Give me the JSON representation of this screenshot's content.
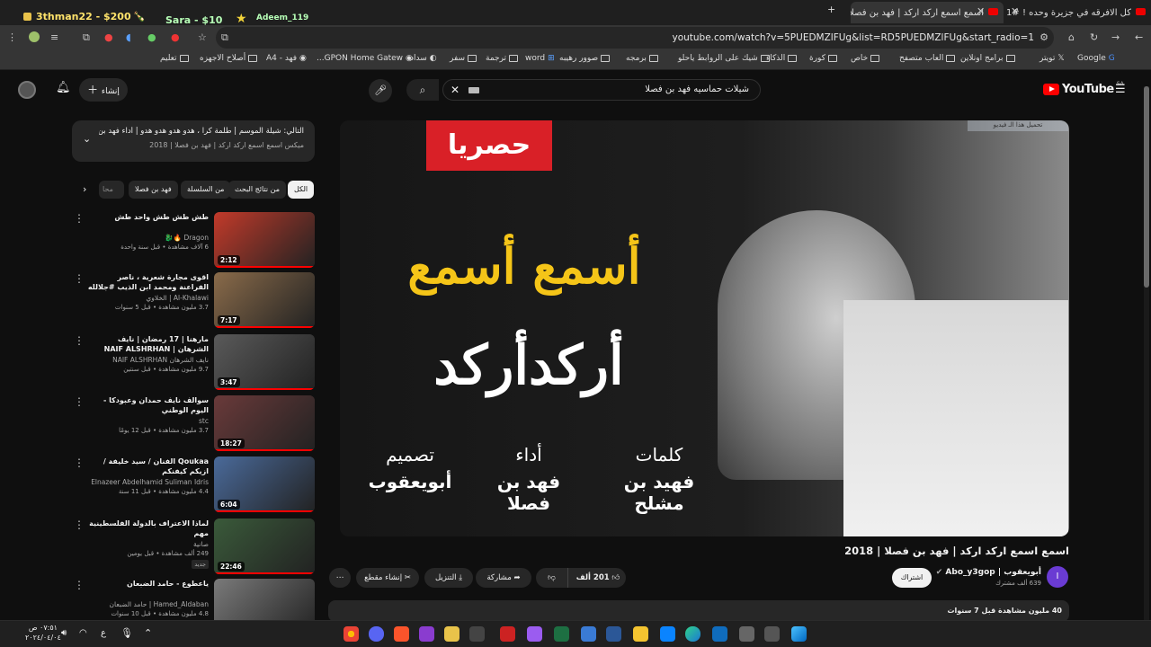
{
  "overlay": {
    "user1": "3thman22 - $200",
    "user2": "Sara - $10",
    "user3": "Adeem_119"
  },
  "tabs": [
    {
      "title": "كل الافرقه في جزيرة وحده ! #1 -"
    },
    {
      "title": "اسمع اسمع اركد اركد | فهد بن فصلا"
    },
    {
      "title": "فهد بن"
    }
  ],
  "address": {
    "url": "youtube.com/watch?v=5PUEDMZlFUg&list=RD5PUEDMZlFUg&start_radio=1"
  },
  "bookmarks": [
    {
      "label": "Google"
    },
    {
      "label": "تويتر"
    },
    {
      "label": "برامج اونلاين"
    },
    {
      "label": "العاب متصفح"
    },
    {
      "label": "خاص"
    },
    {
      "label": "كورة"
    },
    {
      "label": "الذكاء"
    },
    {
      "label": "شيك على الروابط ياحلو"
    },
    {
      "label": "برمجه"
    },
    {
      "label": "صوور رهيبه"
    },
    {
      "label": "word"
    },
    {
      "label": "ترجمة"
    },
    {
      "label": "سفر"
    },
    {
      "label": "سداد"
    },
    {
      "label": "GPON Home Gatew..."
    },
    {
      "label": "فهد - A4"
    },
    {
      "label": "أصلاح الاجهزه"
    },
    {
      "label": "تعليم"
    }
  ],
  "yt": {
    "logo": "YouTube",
    "region": "SA",
    "search_value": "شيلات حماسيه فهد بن فصلا",
    "create_label": "إنشاء"
  },
  "next": {
    "line1": "التالي: شيلة الموسم | طلمة كرا ، هدو هدو هدو هدو | أداء فهد بن فصلا | ...",
    "line2": "ميكس اسمع اسمع اركد اركد | فهد بن فصلا | 2018"
  },
  "chips": [
    "الكل",
    "من نتائج البحث",
    "من السلسلة",
    "فهد بن فصلا",
    "محا"
  ],
  "recs": [
    {
      "title": "طش طش طش واحد طش",
      "channel": "Dragon 🔥🐉",
      "meta": "6 آلاف مشاهدة • قبل سنة واحدة",
      "duration": "2:12",
      "thumb_color": "#c23a2a"
    },
    {
      "title": "اقوى مجارة شعرية ، ناصر الفراعنة ومحمد ابن الذيب #جلالله",
      "channel": "Al-Khalawi | الخلاوي",
      "meta": "3.7 مليون مشاهدة • قبل 5 سنوات",
      "duration": "7:17",
      "thumb_color": "#8a6b4a"
    },
    {
      "title": "مارهنا | 17 رمضان | نايف الشرهان | NAIF ALSHRHAN",
      "channel": "نايف الشرهان NAIF ALSHRHAN",
      "meta": "9.7 مليون مشاهدة • قبل سنتين",
      "duration": "3:47",
      "thumb_color": "#5a5a5a"
    },
    {
      "title": "سوالف نايف حمدان وعبودكا - اليوم الوطني",
      "channel": "stc",
      "meta": "3.7 مليون مشاهدة • قبل 12 يومًا",
      "duration": "18:27",
      "thumb_color": "#6a3a3a"
    },
    {
      "title": "Qoukaa الفنان / سيد خليفة / ازيكم كيفنكم",
      "channel": "Elnazeer Abdelhamid Suliman Idris",
      "meta": "4.4 مليون مشاهدة • قبل 11 سنة",
      "duration": "6:04",
      "thumb_color": "#4a6a9a"
    },
    {
      "title": "لماذا الاعتراف بالدولة الفلسطينية مهم",
      "channel": "صانية",
      "meta": "249 ألف مشاهدة • قبل يومين",
      "duration": "22:46",
      "thumb_color": "#3a5a3a",
      "badge": "جديد"
    },
    {
      "title": "ياعطوع - حامد الضبعان",
      "channel": "Hamed_Aldaban | حامد الضبعان",
      "meta": "4.8 مليون مشاهدة • قبل 10 سنوات",
      "duration": "",
      "thumb_color": "#7a7a7a"
    }
  ],
  "video": {
    "exclusive": "حصريا",
    "big1": "أسمع أسمع",
    "big2": "أركدأركد",
    "credits": [
      {
        "role": "كلمات",
        "name": "فهيد بن مشلح"
      },
      {
        "role": "أداء",
        "name": "فهد بن فصلا"
      },
      {
        "role": "تصميم",
        "name": "أبويعقوب"
      }
    ],
    "corner": "تحميل هذا الـ فيديو",
    "title": "اسمع اسمع اركد اركد | فهد بن فصلا | 2018"
  },
  "channel": {
    "name": "أبويعقوب | Abo_y3gop",
    "subs": "639 ألف مشترك",
    "subscribe": "اشتراك",
    "avatar": "I"
  },
  "actions": {
    "likes": "201 ألف",
    "share": "مشاركة",
    "download": "التنزيل",
    "clip": "إنشاء مقطع"
  },
  "desc": {
    "line": "40 مليون مشاهدة قبل 7 سنوات"
  },
  "taskbar": {
    "time": "٠٧:٥١ ص",
    "date": "٢٠٢٤/٠٤/٠٤",
    "lang": "ع"
  }
}
